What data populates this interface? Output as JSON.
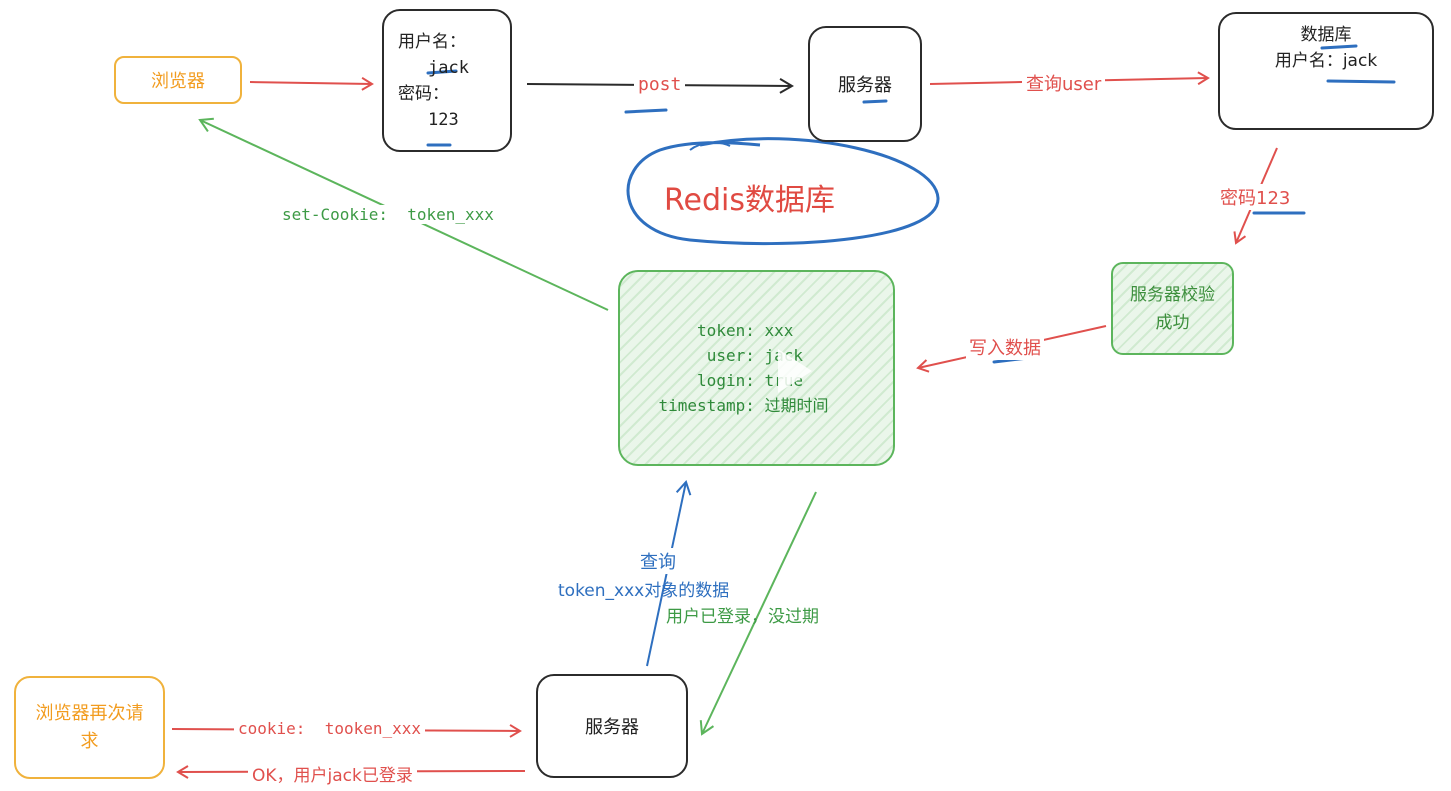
{
  "nodes": {
    "browser": "浏览器",
    "login_form": {
      "username_label": "用户名：",
      "username_value": "jack",
      "password_label": "密码：",
      "password_value": "123"
    },
    "server_top": "服务器",
    "database": {
      "title": "数据库",
      "username": "用户名：jack"
    },
    "validate": {
      "line1": "服务器校验",
      "line2": "成功"
    },
    "redis_title": "Redis数据库",
    "redis_store": {
      "rows": [
        {
          "key": "token:",
          "value": "xxx"
        },
        {
          "key": "user:",
          "value": "jack"
        },
        {
          "key": "login:",
          "value": "true"
        },
        {
          "key": "timestamp:",
          "value": "过期时间"
        }
      ]
    },
    "browser_again": {
      "line1": "浏览器再次请",
      "line2": "求"
    },
    "server_bottom": "服务器"
  },
  "edges": {
    "post": "post",
    "query_user": "查询user",
    "password_check": "密码123",
    "write_data": "写入数据",
    "set_cookie": "set-Cookie:  token_xxx",
    "query_token_line1": "查询",
    "query_token_line2": "token_xxx对象的数据",
    "logged_in": "用户已登录，没过期",
    "cookie": "cookie:  tooken_xxx",
    "ok": "OK，用户jack已登录"
  },
  "colors": {
    "red": "#e0504d",
    "green": "#3d9a45",
    "blue": "#2e6fbf",
    "orange": "#f29c1f",
    "black": "#2b2b2b"
  }
}
